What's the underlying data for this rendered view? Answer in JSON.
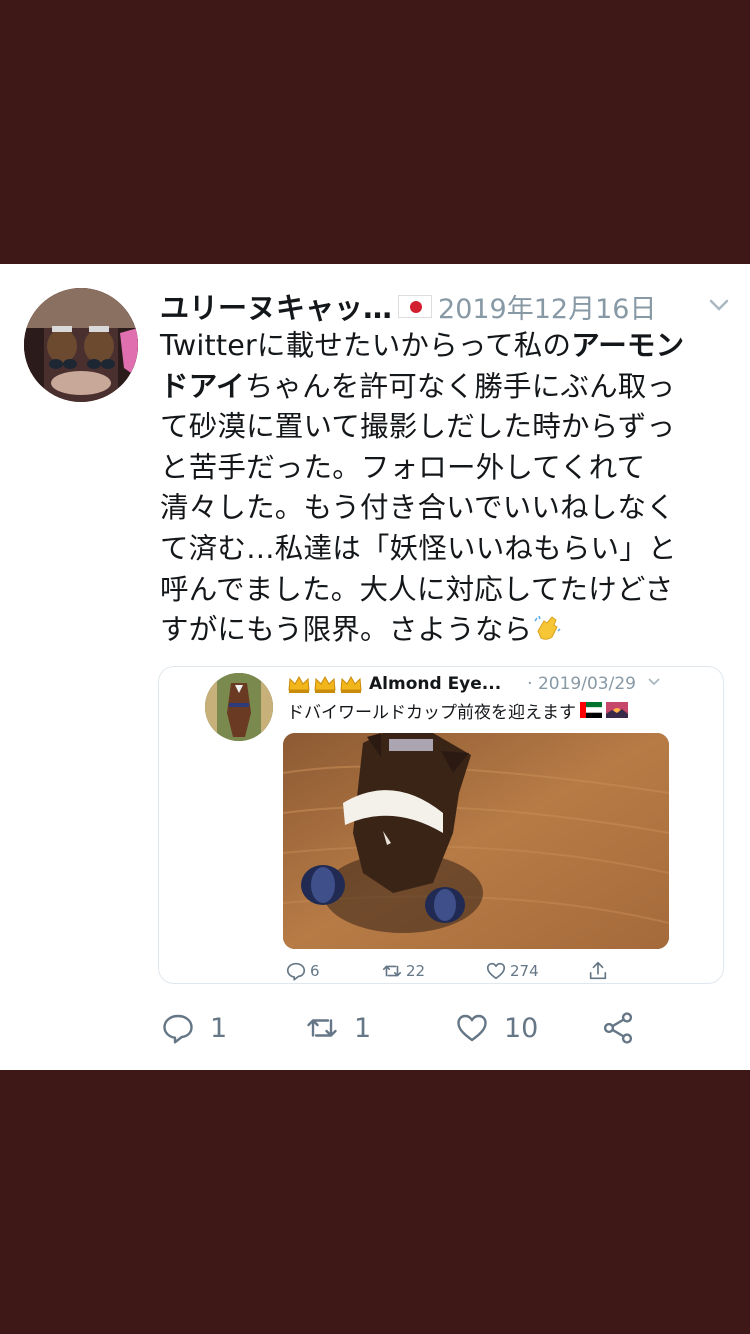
{
  "tweet": {
    "author_name": "ユリーヌキャッ…",
    "date": "2019年12月16日",
    "body_lines": [
      [
        "Twitterに載せたいからって私の",
        "アーモン"
      ],
      [
        "ドアイ",
        "ちゃんを許可なく勝手にぶん取っ"
      ],
      [
        "て砂漠に置いて撮影しだした時からずっ",
        ""
      ],
      [
        "と苦手だった。フォロー外してくれて",
        ""
      ],
      [
        "清々した。もう付き合いでいいねしなく",
        ""
      ],
      [
        "て済む…私達は「妖怪いいねもらい」と",
        ""
      ],
      [
        "呼んでました。大人に対応してたけどさ",
        ""
      ],
      [
        "すがにもう限界。さようなら",
        ""
      ]
    ],
    "line1_a": "Twitterに載せたいからって私の",
    "line1_b": "アーモン",
    "line2_a": "ドアイ",
    "line2_b": "ちゃんを許可なく勝手にぶん取っ",
    "line3": "て砂漠に置いて撮影しだした時からずっ",
    "line4": "と苦手だった。フォロー外してくれて",
    "line5": "清々した。もう付き合いでいいねしなく",
    "line6": "て済む…私達は「妖怪いいねもらい」と",
    "line7": "呼んでました。大人に対応してたけどさ",
    "line8": "すがにもう限界。さようなら",
    "reply_count": "1",
    "retweet_count": "1",
    "like_count": "10",
    "icons": {
      "flag": "japan-flag-icon",
      "caret": "chevron-down-icon",
      "emoji": "clapping-hands-icon",
      "reply": "reply-icon",
      "retweet": "retweet-icon",
      "like": "heart-icon",
      "share": "share-icon"
    }
  },
  "quoted_tweet": {
    "author_name": "Almond Eye...",
    "date": "· 2019/03/29",
    "text": "ドバイワールドカップ前夜を迎えます",
    "reply_count": "6",
    "retweet_count": "22",
    "like_count": "274",
    "icons": {
      "crowns": "crown-icon",
      "flag": "uae-flag-icon",
      "scene": "sunset-icon"
    }
  },
  "colors": {
    "background": "#3e1816",
    "text_primary": "#14171a",
    "text_secondary": "#657786",
    "date_gray": "#8899a6"
  }
}
